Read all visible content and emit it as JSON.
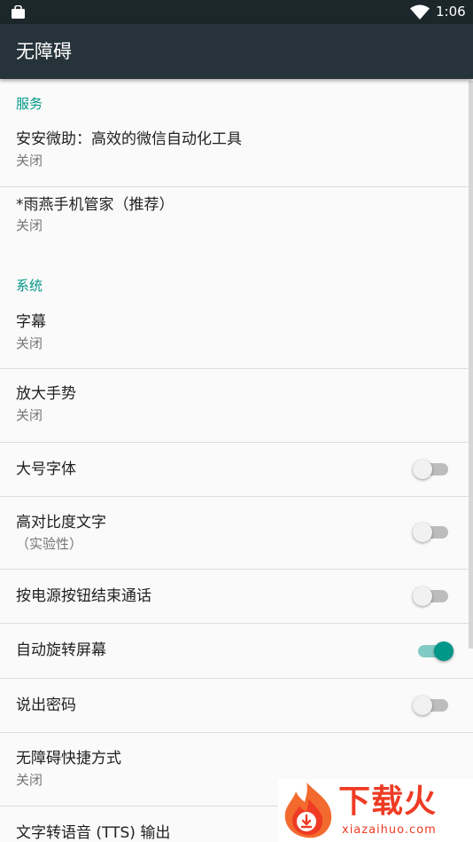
{
  "status_bar": {
    "time": "1:06",
    "icons": [
      "shopping-bag-icon",
      "wifi-icon",
      "battery-icon"
    ]
  },
  "app_bar": {
    "title": "无障碍"
  },
  "sections": {
    "services": {
      "header": "服务",
      "items": [
        {
          "title": "安安微助：高效的微信自动化工具",
          "summary": "关闭"
        },
        {
          "title": "*雨燕手机管家（推荐）",
          "summary": "关闭"
        }
      ]
    },
    "system": {
      "header": "系统",
      "items": [
        {
          "title": "字幕",
          "summary": "关闭"
        },
        {
          "title": "放大手势",
          "summary": "关闭"
        },
        {
          "title": "大号字体",
          "checked": false
        },
        {
          "title": "高对比度文字",
          "summary": "（实验性）",
          "checked": false
        },
        {
          "title": "按电源按钮结束通话",
          "checked": false
        },
        {
          "title": "自动旋转屏幕",
          "checked": true
        },
        {
          "title": "说出密码",
          "checked": false
        },
        {
          "title": "无障碍快捷方式",
          "summary": "关闭"
        },
        {
          "title": "文字转语音 (TTS) 输出"
        }
      ]
    }
  },
  "colors": {
    "accent": "#009688",
    "app_bar": "#26333a",
    "status_bar": "#1c272b",
    "watermark": "#ef3b24"
  },
  "watermark": {
    "brand": "下载火",
    "domain": "xiazaihuo.com"
  }
}
